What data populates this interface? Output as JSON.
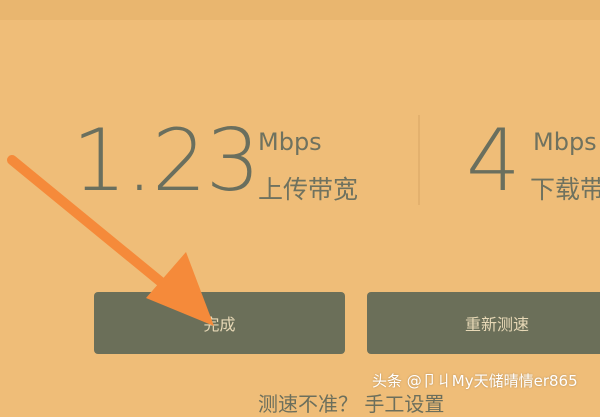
{
  "upload": {
    "value": "1.23",
    "unit": "Mbps",
    "label": "上传带宽"
  },
  "download": {
    "value": "4",
    "unit": "Mbps",
    "label": "下载带"
  },
  "buttons": {
    "done_label": "完成",
    "retest_label": "重新测速"
  },
  "tip_text": "测速不准？ 手工设置",
  "watermark": "头条 @卩丩My天储晴情er865",
  "colors": {
    "background": "#efbd78",
    "button": "#6b6f59",
    "text": "#6a6f5e",
    "arrow": "#f58a3a"
  }
}
